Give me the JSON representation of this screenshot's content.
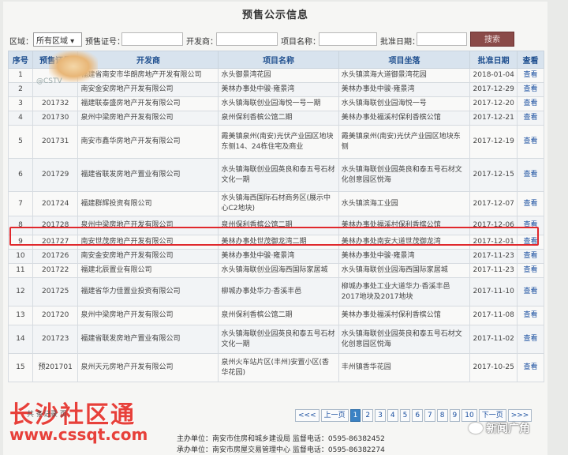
{
  "page_title": "预售公示信息",
  "filter": {
    "region_label": "区域：",
    "region_value": "所有区域 ▾",
    "presale_label": "预售证号：",
    "developer_label": "开发商：",
    "project_label": "项目名称：",
    "date_label": "批准日期：",
    "search_button": "搜索"
  },
  "table": {
    "headers": [
      "序号",
      "预售证号",
      "开发商",
      "项目名称",
      "项目坐落",
      "批准日期",
      "查看"
    ],
    "rows": [
      {
        "no": "1",
        "cert": "",
        "dev": "福建省南安市华朗房地产开发有限公司",
        "proj": "水头御景湾花园",
        "loc": "水头镇滨海大道御景湾花园",
        "date": "2018-01-04",
        "view": "查看"
      },
      {
        "no": "2",
        "cert": "",
        "dev": "南安金安房地产开发有限公司",
        "proj": "美林办事处中骏·雍景湾",
        "loc": "美林办事处中骏·雍景湾",
        "date": "2017-12-29",
        "view": "查看"
      },
      {
        "no": "3",
        "cert": "201732",
        "dev": "福建联泰盛房地产开发有限公司",
        "proj": "水头镇海联创业园海悦一号一期",
        "loc": "水头镇海联创业园海悦一号",
        "date": "2017-12-20",
        "view": "查看"
      },
      {
        "no": "4",
        "cert": "201730",
        "dev": "泉州中梁房地产开发有限公司",
        "proj": "泉州保利香槟公馆二期",
        "loc": "美林办事处福溪村保利香槟公馆",
        "date": "2017-12-21",
        "view": "查看"
      },
      {
        "no": "5",
        "cert": "201731",
        "dev": "南安市鑫华房地产开发有限公司",
        "proj": "霞美镇泉州(南安)光伏产业园区地块东侧14、24栋住宅及商业",
        "loc": "霞美镇泉州(南安)光伏产业园区地块东侧",
        "date": "2017-12-19",
        "view": "查看"
      },
      {
        "no": "6",
        "cert": "201729",
        "dev": "福建省联发房地产置业有限公司",
        "proj": "水头镇海联创业园英良和泰五号石材文化一期",
        "loc": "水头镇海联创业园英良和泰五号石材文化创意园区悦海",
        "date": "2017-12-15",
        "view": "查看"
      },
      {
        "no": "7",
        "cert": "201724",
        "dev": "福建群辉投资有限公司",
        "proj": "水头镇海西国际石材商务区(展示中心C2地块)",
        "loc": "水头镇滨海工业园",
        "date": "2017-12-07",
        "view": "查看"
      },
      {
        "no": "8",
        "cert": "201728",
        "dev": "泉州中梁房地产开发有限公司",
        "proj": "泉州保利香槟公馆二期",
        "loc": "美林办事处福溪村保利香槟公馆",
        "date": "2017-12-06",
        "view": "查看"
      },
      {
        "no": "9",
        "cert": "201727",
        "dev": "南安世茂房地产开发有限公司",
        "proj": "美林办事处世茂御龙湾二期",
        "loc": "美林办事处南安大道世茂御龙湾",
        "date": "2017-12-01",
        "view": "查看"
      },
      {
        "no": "10",
        "cert": "201726",
        "dev": "南安金安房地产开发有限公司",
        "proj": "美林办事处中骏·雍景湾",
        "loc": "美林办事处中骏·雍景湾",
        "date": "2017-11-23",
        "view": "查看"
      },
      {
        "no": "11",
        "cert": "201722",
        "dev": "福建北辰置业有限公司",
        "proj": "水头镇海联创业园海西国际家居城",
        "loc": "水头镇海联创业园海西国际家居城",
        "date": "2017-11-23",
        "view": "查看"
      },
      {
        "no": "12",
        "cert": "201725",
        "dev": "福建省华力佳置业投资有限公司",
        "proj": "柳城办事处华力·香溪丰邑",
        "loc": "柳城办事处工业大道华力·香溪丰邑2017地块及2017地块",
        "date": "2017-11-10",
        "view": "查看"
      },
      {
        "no": "13",
        "cert": "201720",
        "dev": "泉州中梁房地产开发有限公司",
        "proj": "泉州保利香槟公馆二期",
        "loc": "美林办事处福溪村保利香槟公馆",
        "date": "2017-11-08",
        "view": "查看"
      },
      {
        "no": "14",
        "cert": "201723",
        "dev": "福建省联发房地产置业有限公司",
        "proj": "水头镇海联创业园英良和泰五号石材文化一期",
        "loc": "水头镇海联创业园英良和泰五号石材文化创意园区悦海",
        "date": "2017-11-02",
        "view": "查看"
      },
      {
        "no": "15",
        "cert": "预201701",
        "dev": "泉州天元房地产开发有限公司",
        "proj": "泉州火车站片区(丰州)安置小区(香华花园)",
        "loc": "丰州镇香华花园",
        "date": "2017-10-25",
        "view": "查看"
      }
    ]
  },
  "pager": {
    "first": "<<<",
    "prev": "上一页",
    "pages": [
      "1",
      "2",
      "3",
      "4",
      "5",
      "6",
      "7",
      "8",
      "9",
      "10"
    ],
    "next": "下一页",
    "last": ">>>"
  },
  "footer": {
    "line1": "主办单位：南安市住房和城乡建设局   监督电话：0595-86382452",
    "line2": "承办单位：南安市房屋交易管理中心   监督电话：0595-86382274"
  },
  "watermarks": {
    "brand": "长沙社区通",
    "url": "www.cssqt.com",
    "logo_text": "@CSTV",
    "news": "新闻广角",
    "partial": "共 条记录 页"
  }
}
